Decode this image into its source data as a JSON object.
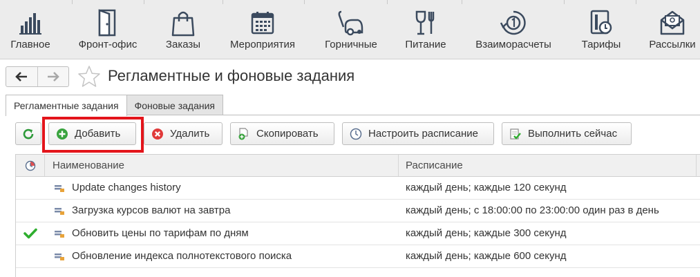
{
  "topnav": {
    "items": [
      {
        "label": "Главное",
        "icon": "bar-chart-icon"
      },
      {
        "label": "Фронт-офис",
        "icon": "door-icon"
      },
      {
        "label": "Заказы",
        "icon": "shopping-bag-icon"
      },
      {
        "label": "Мероприятия",
        "icon": "calendar-icon"
      },
      {
        "label": "Горничные",
        "icon": "vacuum-cleaner-icon"
      },
      {
        "label": "Питание",
        "icon": "wine-fork-icon"
      },
      {
        "label": "Взаиморасчеты",
        "icon": "coin-exchange-icon"
      },
      {
        "label": "Тарифы",
        "icon": "tariff-icon"
      },
      {
        "label": "Рассылки",
        "icon": "mail-icon"
      }
    ]
  },
  "page": {
    "title": "Регламентные и фоновые задания"
  },
  "tabs": [
    {
      "label": "Регламентные задания",
      "active": true
    },
    {
      "label": "Фоновые задания",
      "active": false
    }
  ],
  "toolbar": {
    "add_label": "Добавить",
    "delete_label": "Удалить",
    "copy_label": "Скопировать",
    "schedule_label": "Настроить расписание",
    "run_label": "Выполнить сейчас"
  },
  "table": {
    "columns": {
      "name": "Наименование",
      "schedule": "Расписание"
    },
    "rows": [
      {
        "name": "Update changes history",
        "schedule": "каждый день; каждые 120 секунд",
        "enabled": false
      },
      {
        "name": "Загрузка курсов валют на завтра",
        "schedule": "каждый день; с 18:00:00 по 23:00:00 один раз в день",
        "enabled": false
      },
      {
        "name": "Обновить цены по тарифам по дням",
        "schedule": "каждый день; каждые 300 секунд",
        "enabled": true
      },
      {
        "name": "Обновление индекса полнотекстового поиска",
        "schedule": "каждый день; каждые 600 секунд",
        "enabled": false
      }
    ]
  },
  "colors": {
    "highlight": "#e3151b",
    "add_green": "#3aa43f",
    "delete_red": "#e03a3a",
    "check_green": "#2fae2f"
  }
}
